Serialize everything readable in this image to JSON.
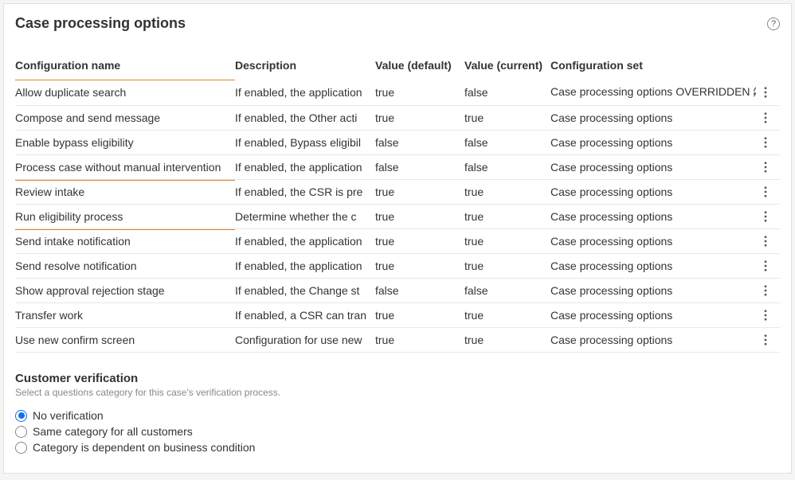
{
  "title": "Case processing options",
  "help_label": "?",
  "columns": {
    "name": "Configuration name",
    "desc": "Description",
    "vdef": "Value (default)",
    "vcur": "Value (current)",
    "cset": "Configuration set"
  },
  "rows": [
    {
      "name": "Allow duplicate search",
      "desc": "If enabled, the application",
      "vdef": "true",
      "vcur": "false",
      "cset": "Case processing options OVERRIDDEN",
      "overridden": true,
      "highlight": true
    },
    {
      "name": "Compose and send message",
      "desc": "If enabled, the Other acti",
      "vdef": "true",
      "vcur": "true",
      "cset": "Case processing options",
      "overridden": false,
      "highlight": false
    },
    {
      "name": "Enable bypass eligibility",
      "desc": "If enabled, Bypass eligibil",
      "vdef": "false",
      "vcur": "false",
      "cset": "Case processing options",
      "overridden": false,
      "highlight": false
    },
    {
      "name": "Process case without manual intervention",
      "desc": "If enabled, the application",
      "vdef": "false",
      "vcur": "false",
      "cset": "Case processing options",
      "overridden": false,
      "highlight": false
    },
    {
      "name": "Review intake",
      "desc": "If enabled, the CSR is pre",
      "vdef": "true",
      "vcur": "true",
      "cset": "Case processing options",
      "overridden": false,
      "highlight": true
    },
    {
      "name": "Run eligibility process",
      "desc": "Determine whether the c",
      "vdef": "true",
      "vcur": "true",
      "cset": "Case processing options",
      "overridden": false,
      "highlight": false
    },
    {
      "name": "Send intake notification",
      "desc": "If enabled, the application",
      "vdef": "true",
      "vcur": "true",
      "cset": "Case processing options",
      "overridden": false,
      "highlight": true
    },
    {
      "name": "Send resolve notification",
      "desc": "If enabled, the application",
      "vdef": "true",
      "vcur": "true",
      "cset": "Case processing options",
      "overridden": false,
      "highlight": false
    },
    {
      "name": "Show approval rejection stage",
      "desc": "If enabled, the Change st",
      "vdef": "false",
      "vcur": "false",
      "cset": "Case processing options",
      "overridden": false,
      "highlight": false
    },
    {
      "name": "Transfer work",
      "desc": "If enabled, a CSR can tran",
      "vdef": "true",
      "vcur": "true",
      "cset": "Case processing options",
      "overridden": false,
      "highlight": false
    },
    {
      "name": "Use new confirm screen",
      "desc": "Configuration for use new",
      "vdef": "true",
      "vcur": "true",
      "cset": "Case processing options",
      "overridden": false,
      "highlight": false
    }
  ],
  "verification": {
    "title": "Customer verification",
    "subtitle": "Select a questions category for this case's verification process.",
    "options": [
      {
        "label": "No verification",
        "selected": true
      },
      {
        "label": "Same category for all customers",
        "selected": false
      },
      {
        "label": "Category is dependent on business condition",
        "selected": false
      }
    ]
  }
}
